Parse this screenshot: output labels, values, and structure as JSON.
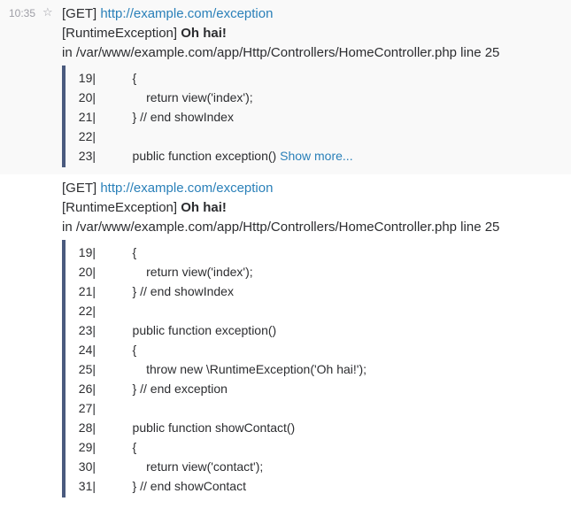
{
  "colors": {
    "link": "#2a80b9",
    "code_border": "#4a5a7e",
    "hover_bg": "#f9f9f9",
    "meta_text": "#9e9ea6"
  },
  "messages": [
    {
      "timestamp": "10:35",
      "star_icon": "star-icon",
      "method": "[GET]",
      "url": "http://example.com/exception",
      "exception_class": "[RuntimeException]",
      "exception_message": "Oh hai!",
      "location": "in /var/www/example.com/app/Http/Controllers/HomeController.php line 25",
      "code": [
        {
          "no": "19|",
          "text": "    {"
        },
        {
          "no": "20|",
          "text": "        return view('index');"
        },
        {
          "no": "21|",
          "text": "    } // end showIndex"
        },
        {
          "no": "22|",
          "text": ""
        },
        {
          "no": "23|",
          "text": "    public function exception()"
        }
      ],
      "show_more": "Show more..."
    },
    {
      "method": "[GET]",
      "url": "http://example.com/exception",
      "exception_class": "[RuntimeException]",
      "exception_message": "Oh hai!",
      "location": "in /var/www/example.com/app/Http/Controllers/HomeController.php line 25",
      "code": [
        {
          "no": "19|",
          "text": "    {"
        },
        {
          "no": "20|",
          "text": "        return view('index');"
        },
        {
          "no": "21|",
          "text": "    } // end showIndex"
        },
        {
          "no": "22|",
          "text": ""
        },
        {
          "no": "23|",
          "text": "    public function exception()"
        },
        {
          "no": "24|",
          "text": "    {"
        },
        {
          "no": "25|",
          "text": "        throw new \\RuntimeException('Oh hai!');"
        },
        {
          "no": "26|",
          "text": "    } // end exception"
        },
        {
          "no": "27|",
          "text": ""
        },
        {
          "no": "28|",
          "text": "    public function showContact()"
        },
        {
          "no": "29|",
          "text": "    {"
        },
        {
          "no": "30|",
          "text": "        return view('contact');"
        },
        {
          "no": "31|",
          "text": "    } // end showContact"
        }
      ]
    }
  ]
}
